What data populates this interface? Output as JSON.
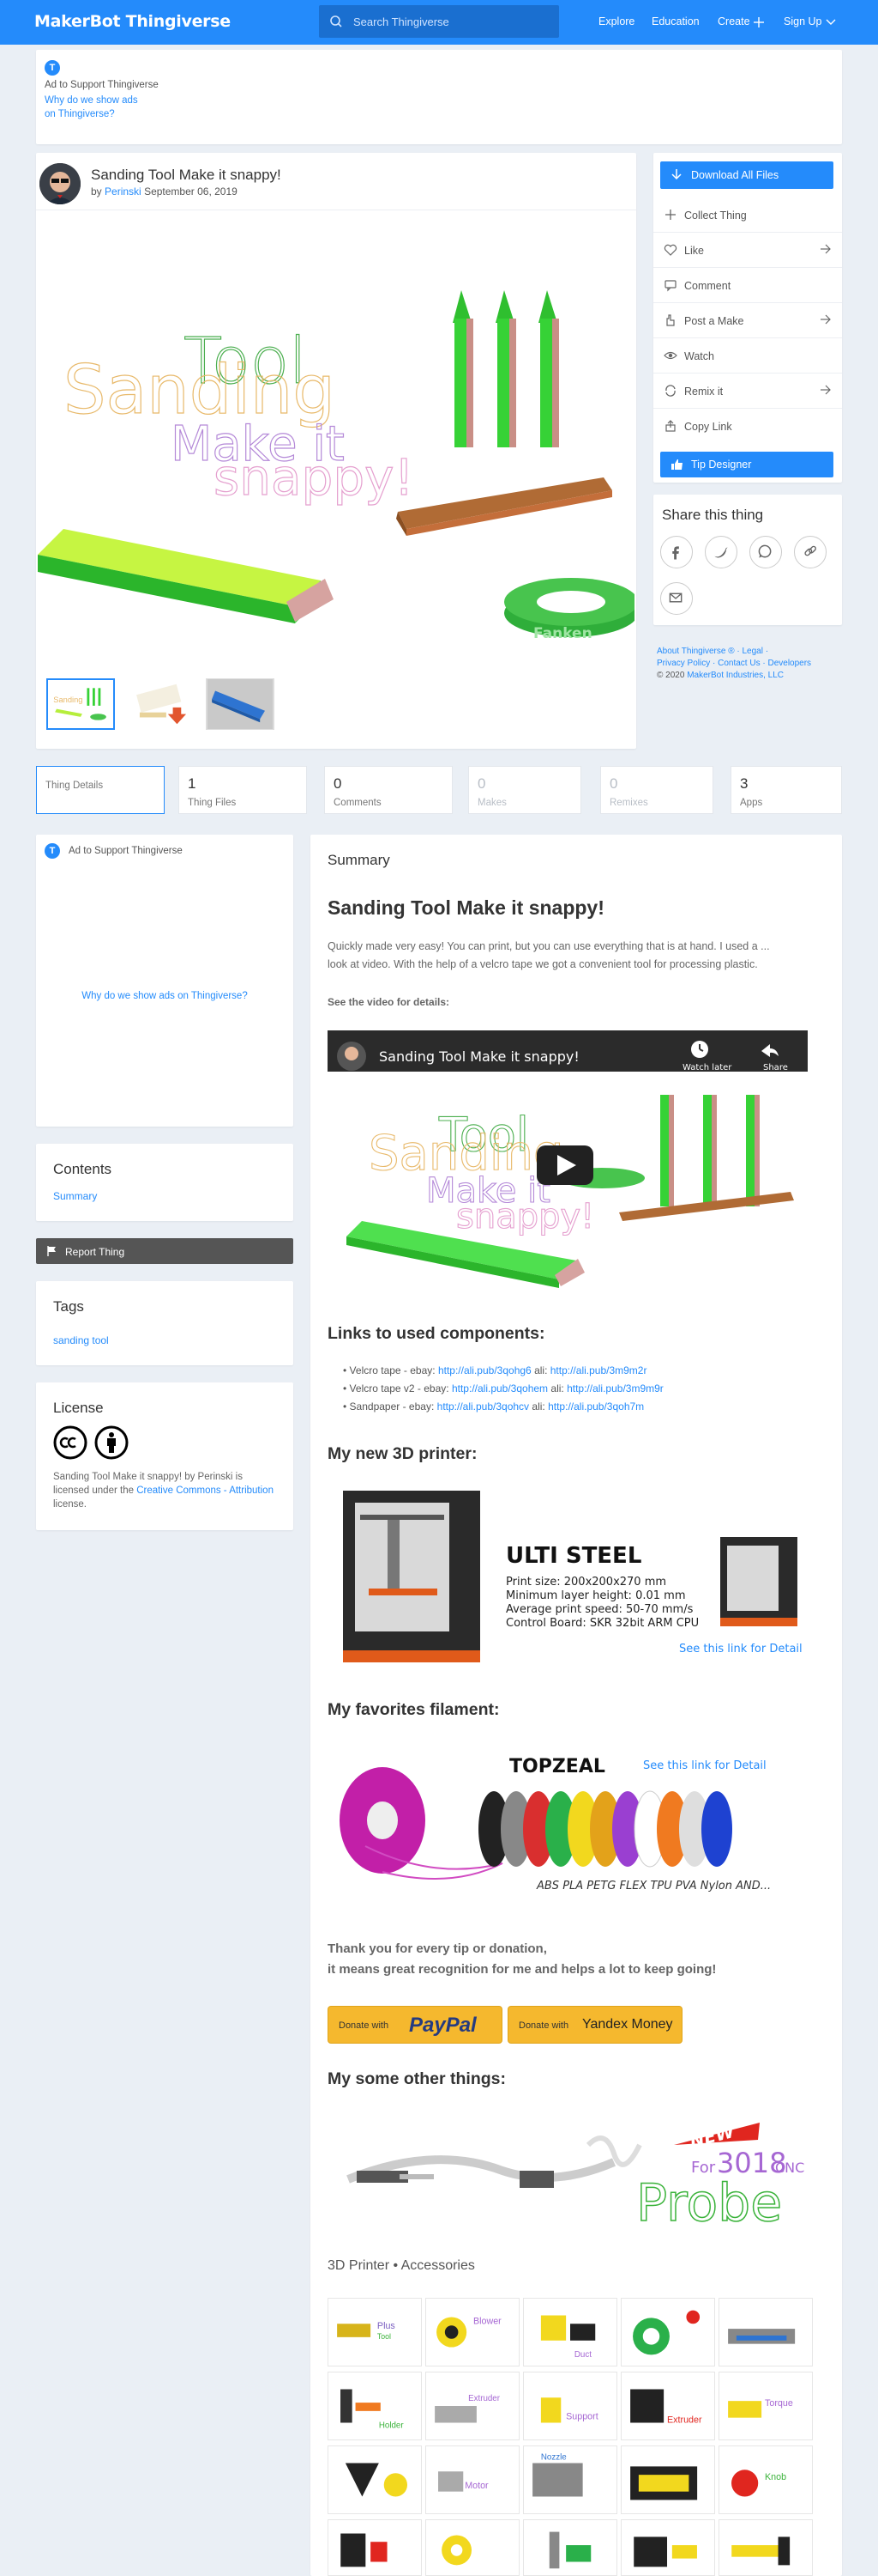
{
  "header": {
    "logo_bold": "MakerBot",
    "logo_light": "Thingiverse",
    "search_placeholder": "Search Thingiverse",
    "nav": [
      "Explore",
      "Education",
      "Create",
      "Sign Up"
    ]
  },
  "ad_top": {
    "badge": "T",
    "label": "Ad to Support Thingiverse",
    "why_line1": "Why do we show ads",
    "why_line2": "on Thingiverse?"
  },
  "thing": {
    "title": "Sanding Tool Make it snappy!",
    "by": "by",
    "author": "Perinski",
    "date": "September 06, 2019",
    "hero_words": [
      "Tool",
      "Sanding",
      "Make it",
      "snappy!"
    ],
    "tape_text": "Fanken"
  },
  "sidebar": {
    "download": "Download All Files",
    "rows": [
      "Collect Thing",
      "Like",
      "Comment",
      "Post a Make",
      "Watch",
      "Remix it",
      "Copy Link"
    ],
    "tip": "Tip Designer",
    "share_title": "Share this thing",
    "legal_line1": "About Thingiverse ® · Legal ·",
    "legal_line2": "Privacy Policy · Contact Us · Developers",
    "copyright": "© 2020",
    "copyright_link": "MakerBot Industries, LLC"
  },
  "tabs": [
    {
      "num": "",
      "label": "Thing Details"
    },
    {
      "num": "1",
      "label": "Thing Files"
    },
    {
      "num": "0",
      "label": "Comments"
    },
    {
      "num": "0",
      "label": "Makes"
    },
    {
      "num": "0",
      "label": "Remixes"
    },
    {
      "num": "3",
      "label": "Apps"
    }
  ],
  "left": {
    "ad_label": "Ad to Support Thingiverse",
    "ad_why": "Why do we show ads on Thingiverse?",
    "contents_title": "Contents",
    "contents_item": "Summary",
    "report": "Report Thing",
    "tags_title": "Tags",
    "tag": "sanding tool",
    "license_title": "License",
    "license_text1": "Sanding Tool Make it snappy! by Perinski is licensed under the",
    "license_link": "Creative Commons - Attribution",
    "license_text2": "license."
  },
  "summary": {
    "heading": "Summary",
    "title": "Sanding Tool Make it snappy!",
    "intro_line1": "Quickly made very easy! You can print, but you can use everything that is at hand. I used a ...",
    "intro_line2": "look at video. With the help of a velcro tape we got a convenient tool for processing plastic.",
    "see_video": "See the video for details:",
    "video_title": "Sanding Tool Make it snappy!",
    "video_watch_later": "Watch later",
    "video_share": "Share",
    "links_heading": "Links to used components:",
    "components": [
      {
        "name": "Velcro tape - ebay:",
        "url1": "http://ali.pub/3qohg6",
        "ali": "ali:",
        "url2": "http://ali.pub/3m9m2r"
      },
      {
        "name": "Velcro tape v2 - ebay:",
        "url1": "http://ali.pub/3qohem",
        "ali": "ali:",
        "url2": "http://ali.pub/3m9m9r"
      },
      {
        "name": "Sandpaper - ebay:",
        "url1": "http://ali.pub/3qohcv",
        "ali": "ali:",
        "url2": "http://ali.pub/3qoh7m"
      }
    ],
    "printer_heading": "My new 3D printer:",
    "printer_name": "ULTI STEEL",
    "printer_specs": [
      "Print size: 200x200x270 mm",
      "Minimum layer height: 0.01 mm",
      "Average print speed: 50-70 mm/s",
      "Control Board: SKR 32bit ARM CPU"
    ],
    "printer_link": "See this link for Detail",
    "filament_heading": "My favorites filament:",
    "filament_brand": "TOPZEAL",
    "filament_link": "See this link for Detail",
    "filament_types": "ABS PLA PETG FLEX TPU PVA Nylon AND...",
    "thanks_line1": "Thank you for every tip or donation,",
    "thanks_line2": "it means great recognition for me and helps a lot to keep going!",
    "donate_with": "Donate with",
    "paypal": "PayPal",
    "yandex": "Yandex Money",
    "other_heading": "My some other things:",
    "probe_new": "NEW",
    "probe_for": "For",
    "probe_model": "3018",
    "probe_cnc": "CNC",
    "probe_word": "Probe",
    "accessories": "3D Printer • Accessories"
  },
  "colors": {
    "brand": "#248bfb",
    "green": "#33cc33",
    "paypal_yellow": "#f5b82e"
  }
}
